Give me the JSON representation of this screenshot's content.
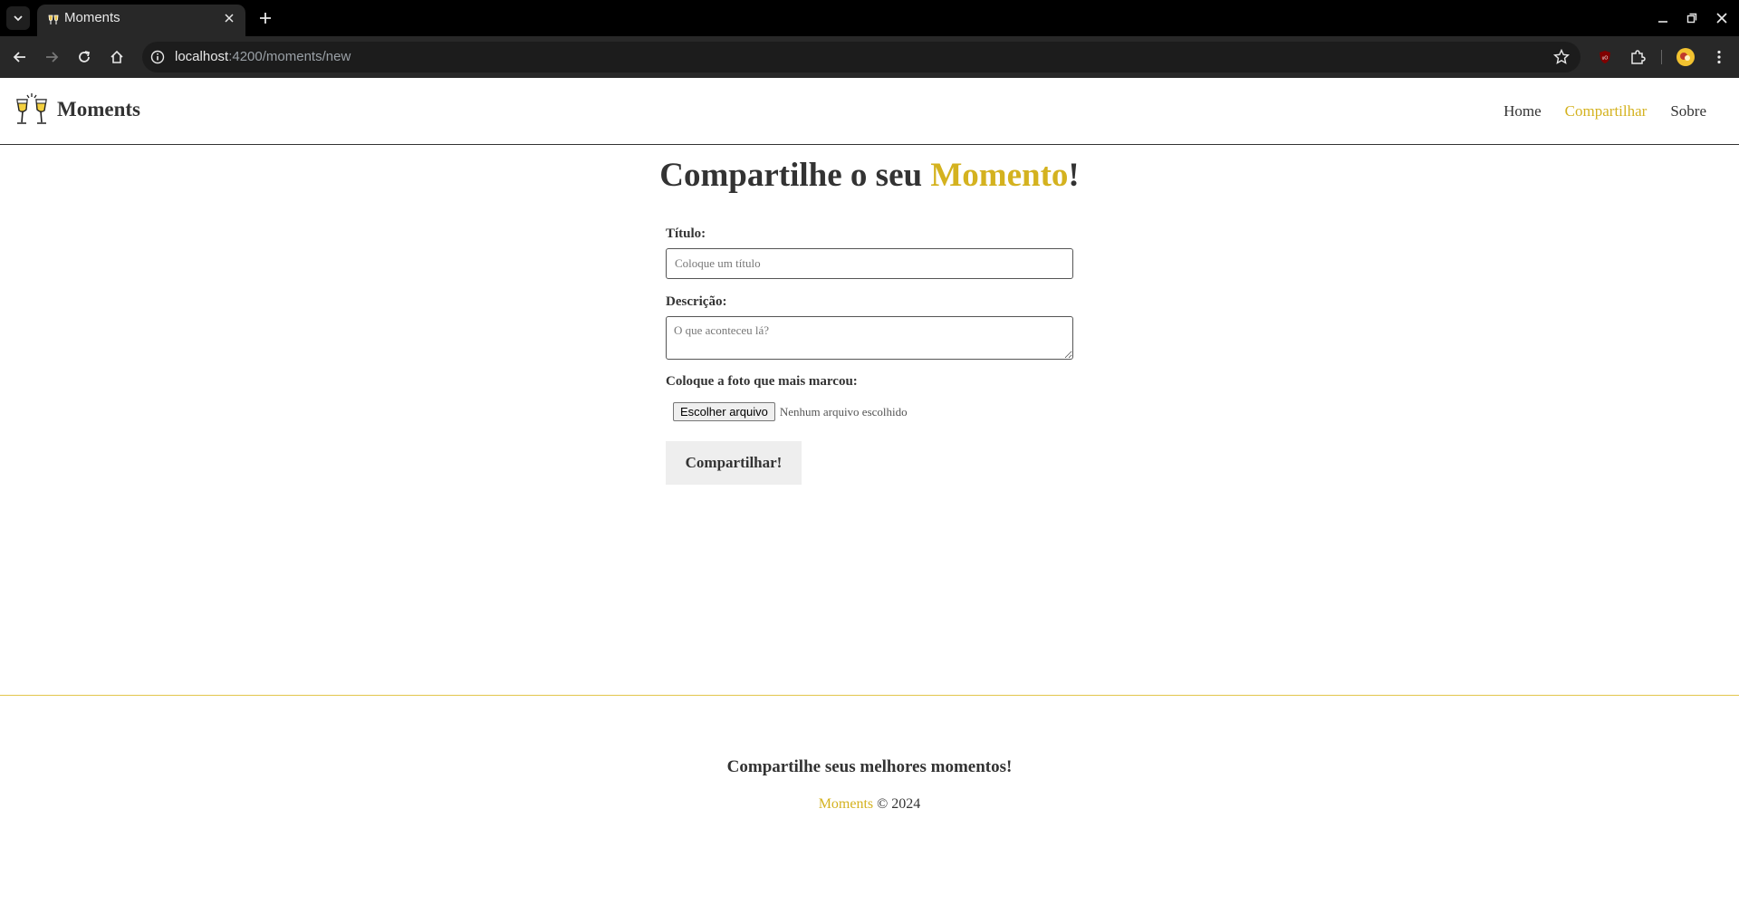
{
  "browser": {
    "tab_title": "Moments",
    "url_host": "localhost",
    "url_path": ":4200/moments/new"
  },
  "navbar": {
    "brand": "Moments",
    "links": [
      {
        "label": "Home"
      },
      {
        "label": "Compartilhar",
        "active": true
      },
      {
        "label": "Sobre"
      }
    ]
  },
  "heading": {
    "prefix": "Compartilhe o seu ",
    "highlight": "Momento",
    "suffix": "!"
  },
  "form": {
    "title_label": "Título:",
    "title_placeholder": "Coloque um título",
    "description_label": "Descrição:",
    "description_placeholder": "O que aconteceu lá?",
    "image_label": "Coloque a foto que mais marcou:",
    "file_button": "Escolher arquivo",
    "file_status": "Nenhum arquivo escolhido",
    "submit_label": "Compartilhar!"
  },
  "footer": {
    "message": "Compartilhe seus melhores momentos!",
    "brand": "Moments",
    "copyright": " © 2024"
  },
  "colors": {
    "accent": "#d4b21f",
    "text": "#333333"
  }
}
